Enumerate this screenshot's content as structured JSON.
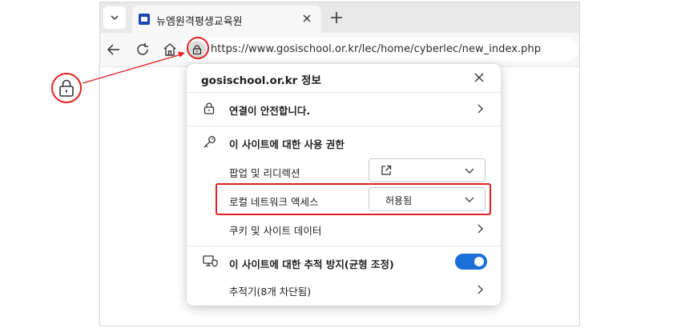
{
  "colors": {
    "accent": "#1a6fd8",
    "annotation": "#e02020",
    "tab_favicon": "#1a45b0"
  },
  "browser": {
    "tab": {
      "title": "뉴엠원격평생교육원",
      "favicon": "site-favicon"
    },
    "url": "https://www.gosischool.or.kr/lec/home/cyberlec/new_index.php",
    "icons": [
      "tab-list-icon",
      "close-icon",
      "new-tab-icon",
      "back-icon",
      "refresh-icon",
      "home-icon",
      "lock-icon"
    ]
  },
  "popup": {
    "title": "gosischool.or.kr 정보",
    "connection": {
      "label": "연결이 안전합니다."
    },
    "permissions": {
      "header": "이 사이트에 대한 사용 권한",
      "popups": {
        "label": "팝업 및 리디렉션",
        "value_icon": "external-link-icon"
      },
      "local_network": {
        "label": "로컬 네트워크 액세스",
        "value": "허용됨"
      },
      "cookies": {
        "label": "쿠키 및 사이트 데이터"
      }
    },
    "tracking": {
      "label": "이 사이트에 대한 추적 방지(균형 조정)",
      "enabled": true,
      "trackers": {
        "label": "추적기(8개 차단됨)"
      }
    }
  }
}
